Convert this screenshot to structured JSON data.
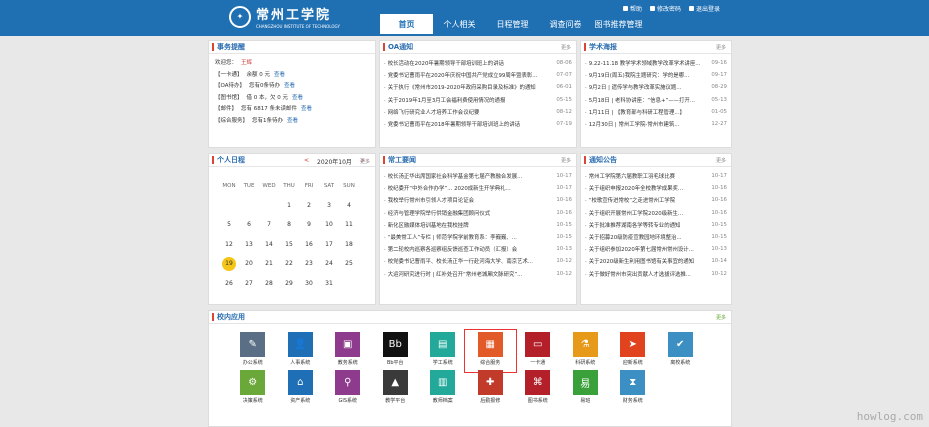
{
  "header": {
    "logo_cn": "常州工学院",
    "logo_en": "CHANGZHOU INSTITUTE OF TECHNOLOGY",
    "links": [
      "帮助",
      "修改密码",
      "退出登录"
    ],
    "nav": [
      "首页",
      "个人相关",
      "日程管理",
      "调查问卷",
      "图书推荐管理"
    ]
  },
  "todo": {
    "title": "事务提醒",
    "welcome_prefix": "欢迎您：",
    "welcome_name": "王辉",
    "rows": [
      {
        "label": "【一卡通】",
        "text": "余额 0 元",
        "action": "查看"
      },
      {
        "label": "【OA待办】",
        "text": "您有0条待办",
        "action": "查看"
      },
      {
        "label": "【图书馆】",
        "text": "借 0 本，欠 0 元",
        "action": "查看"
      },
      {
        "label": "【邮件】",
        "text": "您有 6817 条未读邮件",
        "action": "查看"
      },
      {
        "label": "【综合服务】",
        "text": "您有1条待办",
        "action": "查看"
      }
    ]
  },
  "oa": {
    "title": "OA通知",
    "more": "更多",
    "items": [
      {
        "t": "校长活动在2020年暑期领导干部培训班上的讲话",
        "d": "08-06"
      },
      {
        "t": "党委书记曹雨平在2020年庆祝中国共产党成立99周年暨表彰...",
        "d": "07-07"
      },
      {
        "t": "关于执行《常州市2019-2020年政府采购目录及标准》的通知",
        "d": "06-01"
      },
      {
        "t": "关于2019年1月至3月工会福利费使用情况的通报",
        "d": "05-15"
      },
      {
        "t": "网络飞行研究业人才培养工作会议纪要",
        "d": "08-12"
      },
      {
        "t": "党委书记曹雨平在2018年暑期领导干部培训班上的讲话",
        "d": "07-19"
      }
    ]
  },
  "academic": {
    "title": "学术海报",
    "more": "更多",
    "items": [
      {
        "t": "9.22-11.18 教学学术领域教学改革学术讲座...",
        "d": "09-16"
      },
      {
        "t": "9月19日(周五)我院主题研究：学的是哪...",
        "d": "09-17"
      },
      {
        "t": "9月2日 | 遗传学与教学改革实施议题...",
        "d": "08-29"
      },
      {
        "t": "5月18日 | 老科协讲座：“信息+”——打开...",
        "d": "05-13"
      },
      {
        "t": "1月11日 | 【教育部与科研工程管理...】",
        "d": "01-05"
      },
      {
        "t": "12月30日 | 常州工学院-常州市建筑...",
        "d": "12-27"
      }
    ]
  },
  "calendar": {
    "title": "个人日程",
    "month": "2020年10月",
    "prev": "<",
    "next": ">",
    "more": "更多",
    "weekdays": [
      "MON",
      "TUE",
      "WED",
      "THU",
      "FRI",
      "SAT",
      "SUN"
    ],
    "weeks": [
      [
        "",
        "",
        "",
        "1",
        "2",
        "3",
        "4"
      ],
      [
        "5",
        "6",
        "7",
        "8",
        "9",
        "10",
        "11"
      ],
      [
        "12",
        "13",
        "14",
        "15",
        "16",
        "17",
        "18"
      ],
      [
        "19",
        "20",
        "21",
        "22",
        "23",
        "24",
        "25"
      ],
      [
        "26",
        "27",
        "28",
        "29",
        "30",
        "31",
        ""
      ]
    ],
    "today": "19"
  },
  "work": {
    "title": "常工要闻",
    "more": "更多",
    "items": [
      {
        "t": "校长汤正华出席国家社会科学基金第七届产教融合发展...",
        "d": "10-17"
      },
      {
        "t": "校纪委开“中外合作办学”... 2020成新生开学典礼...",
        "d": "10-17"
      },
      {
        "t": "我校举行常州市引领人才项目论证会",
        "d": "10-16"
      },
      {
        "t": "经济与管理学院举行供销金融集团顾问仪式",
        "d": "10-16"
      },
      {
        "t": "新化区融媒体培训基地在我校挂牌",
        "d": "10-15"
      },
      {
        "t": "“最美常工人”专栏 | 师范学院学前教育系：李巍巍、...",
        "d": "10-15"
      },
      {
        "t": "第二轮校内巡察各巡察组反馈巡查工作动员（汇报）会",
        "d": "10-13"
      },
      {
        "t": "校党委书记曹雨平、校长汤正华一行赴河海大学、南京艺术...",
        "d": "10-12"
      },
      {
        "t": "大运河研究进行时 | 红补处召开“常州老城厢文脉研究”...",
        "d": "10-12"
      }
    ]
  },
  "notice": {
    "title": "通知公告",
    "more": "更多",
    "items": [
      {
        "t": "常州工学院第六届教职工羽毛球比赛",
        "d": "10-17"
      },
      {
        "t": "关于组织申报2020年全校教学成果奖...",
        "d": "10-16"
      },
      {
        "t": "“校歌宣传进常校”之走进常州工学院",
        "d": "10-16"
      },
      {
        "t": "关于组织开展常州工学院2020级新生...",
        "d": "10-16"
      },
      {
        "t": "关于批准推荐湖南各学等转专业的通知",
        "d": "10-15"
      },
      {
        "t": "关于招募20级防疫宣教园地环境整治...",
        "d": "10-15"
      },
      {
        "t": "关于组织参加2020年第七届常州常州设计...",
        "d": "10-13"
      },
      {
        "t": "关于2020级新生利用图书馆有关事宜的通知",
        "d": "10-14"
      },
      {
        "t": "关于做好常州市突出贡献人才选拔评选推...",
        "d": "10-12"
      }
    ]
  },
  "apps_panel": {
    "title": "校内应用",
    "more": "更多",
    "apps": [
      {
        "label": "办公系统",
        "icon": "office-icon",
        "color": "#5a6f86",
        "glyph": "✎"
      },
      {
        "label": "人事系统",
        "icon": "person-icon",
        "color": "#1e6fb5",
        "glyph": "👤"
      },
      {
        "label": "教务系统",
        "icon": "briefcase-icon",
        "color": "#8e3b8e",
        "glyph": "▣"
      },
      {
        "label": "Bb平台",
        "icon": "blackboard-icon",
        "color": "#111111",
        "glyph": "Bb"
      },
      {
        "label": "学工系统",
        "icon": "folder-icon",
        "color": "#22a99a",
        "glyph": "▤"
      },
      {
        "label": "综合服务",
        "icon": "grid-icon",
        "color": "#e25a28",
        "glyph": "▦",
        "selected": true
      },
      {
        "label": "一卡通",
        "icon": "card-icon",
        "color": "#b3202a",
        "glyph": "▭"
      },
      {
        "label": "科研系统",
        "icon": "microscope-icon",
        "color": "#e79a1a",
        "glyph": "⚗"
      },
      {
        "label": "迎新系统",
        "icon": "plane-icon",
        "color": "#e0431d",
        "glyph": "➤"
      },
      {
        "label": "离校系统",
        "icon": "check-icon",
        "color": "#3b8fc2",
        "glyph": "✔"
      },
      {
        "label": "决策系统",
        "icon": "gear-icon",
        "color": "#6aa83a",
        "glyph": "⚙"
      },
      {
        "label": "资产系统",
        "icon": "house-icon",
        "color": "#1e6fb5",
        "glyph": "⌂"
      },
      {
        "label": "GIS系统",
        "icon": "map-pin-icon",
        "color": "#8e3b8e",
        "glyph": "⚲"
      },
      {
        "label": "教学平台",
        "icon": "cap-icon",
        "color": "#3a3a3a",
        "glyph": "▲"
      },
      {
        "label": "教师档案",
        "icon": "archive-icon",
        "color": "#22a99a",
        "glyph": "▥"
      },
      {
        "label": "后勤报修",
        "icon": "repair-icon",
        "color": "#c13a2a",
        "glyph": "✚"
      },
      {
        "label": "图书系统",
        "icon": "library-icon",
        "color": "#b3202a",
        "glyph": "⌘"
      },
      {
        "label": "易班",
        "icon": "eban-icon",
        "color": "#3aa13a",
        "glyph": "易"
      },
      {
        "label": "财务系统",
        "icon": "hourglass-icon",
        "color": "#3b8fc2",
        "glyph": "⧗"
      }
    ]
  },
  "watermark": "howlog.com"
}
